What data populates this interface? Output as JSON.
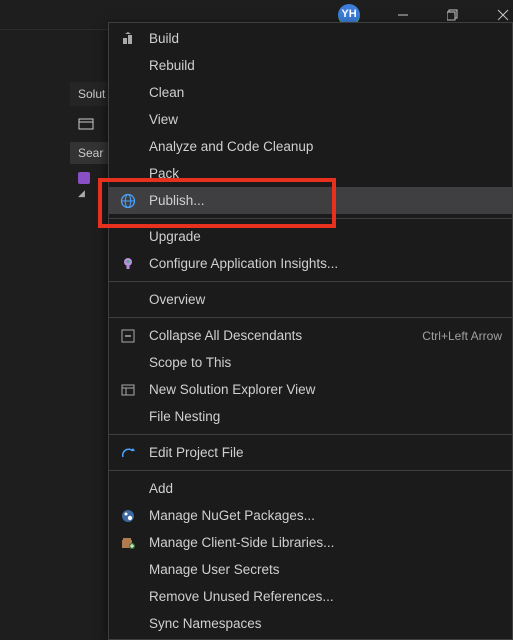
{
  "topbar": {
    "avatar_initials": "YH"
  },
  "panel": {
    "title": "Solut",
    "search_placeholder": "Sear"
  },
  "menu": {
    "items": [
      {
        "icon": "build",
        "label": "Build",
        "shortcut": ""
      },
      {
        "icon": "",
        "label": "Rebuild",
        "shortcut": ""
      },
      {
        "icon": "",
        "label": "Clean",
        "shortcut": ""
      },
      {
        "icon": "",
        "label": "View",
        "shortcut": ""
      },
      {
        "icon": "",
        "label": "Analyze and Code Cleanup",
        "shortcut": ""
      },
      {
        "icon": "",
        "label": "Pack",
        "shortcut": ""
      },
      {
        "icon": "publish",
        "label": "Publish...",
        "shortcut": "",
        "hovered": true
      },
      {
        "sep": true
      },
      {
        "icon": "",
        "label": "Upgrade",
        "shortcut": ""
      },
      {
        "icon": "insights",
        "label": "Configure Application Insights...",
        "shortcut": ""
      },
      {
        "sep": true
      },
      {
        "icon": "",
        "label": "Overview",
        "shortcut": ""
      },
      {
        "sep": true
      },
      {
        "icon": "collapse",
        "label": "Collapse All Descendants",
        "shortcut": "Ctrl+Left Arrow"
      },
      {
        "icon": "",
        "label": "Scope to This",
        "shortcut": ""
      },
      {
        "icon": "newview",
        "label": "New Solution Explorer View",
        "shortcut": ""
      },
      {
        "icon": "",
        "label": "File Nesting",
        "shortcut": ""
      },
      {
        "sep": true
      },
      {
        "icon": "edit",
        "label": "Edit Project File",
        "shortcut": ""
      },
      {
        "sep": true
      },
      {
        "icon": "",
        "label": "Add",
        "shortcut": ""
      },
      {
        "icon": "nuget",
        "label": "Manage NuGet Packages...",
        "shortcut": ""
      },
      {
        "icon": "clientlib",
        "label": "Manage Client-Side Libraries...",
        "shortcut": ""
      },
      {
        "icon": "",
        "label": "Manage User Secrets",
        "shortcut": ""
      },
      {
        "icon": "",
        "label": "Remove Unused References...",
        "shortcut": ""
      },
      {
        "icon": "",
        "label": "Sync Namespaces",
        "shortcut": ""
      }
    ]
  }
}
